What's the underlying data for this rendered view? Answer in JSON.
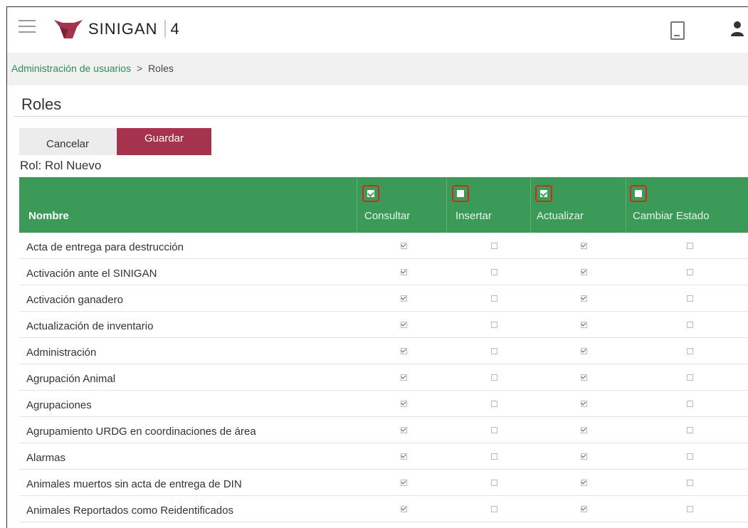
{
  "app": {
    "logo_text": "SINIGAN",
    "logo_version": "4"
  },
  "breadcrumb": {
    "link": "Administración de usuarios",
    "separator": ">",
    "current": "Roles"
  },
  "page": {
    "title": "Roles",
    "cancel_label": "Cancelar",
    "save_label": "Guardar",
    "rol_label": "Rol: Rol Nuevo"
  },
  "table": {
    "name_header": "Nombre",
    "columns": [
      {
        "label": "Consultar",
        "header_checked": true
      },
      {
        "label": "Insertar",
        "header_checked": false
      },
      {
        "label": "Actualizar",
        "header_checked": true
      },
      {
        "label": "Cambiar Estado",
        "header_checked": false
      }
    ],
    "rows": [
      {
        "name": "Acta de entrega para destrucción",
        "perms": [
          true,
          false,
          true,
          false
        ]
      },
      {
        "name": "Activación ante el SINIGAN",
        "perms": [
          true,
          false,
          true,
          false
        ]
      },
      {
        "name": "Activación ganadero",
        "perms": [
          true,
          false,
          true,
          false
        ]
      },
      {
        "name": "Actualización de inventario",
        "perms": [
          true,
          false,
          true,
          false
        ]
      },
      {
        "name": "Administración",
        "perms": [
          true,
          false,
          true,
          false
        ]
      },
      {
        "name": "Agrupación Animal",
        "perms": [
          true,
          false,
          true,
          false
        ]
      },
      {
        "name": "Agrupaciones",
        "perms": [
          true,
          false,
          true,
          false
        ]
      },
      {
        "name": "Agrupamiento URDG en coordinaciones de área",
        "perms": [
          true,
          false,
          true,
          false
        ]
      },
      {
        "name": "Alarmas",
        "perms": [
          true,
          false,
          true,
          false
        ]
      },
      {
        "name": "Animales muertos sin acta de entrega de DIN",
        "perms": [
          true,
          false,
          true,
          false
        ]
      },
      {
        "name": "Animales Reportados como Reidentificados",
        "perms": [
          true,
          false,
          true,
          false
        ]
      }
    ]
  },
  "colors": {
    "header_green": "#3c9a58",
    "save_button": "#a5334e",
    "breadcrumb_link": "#2e8b57",
    "highlight_red": "#e0221e"
  }
}
